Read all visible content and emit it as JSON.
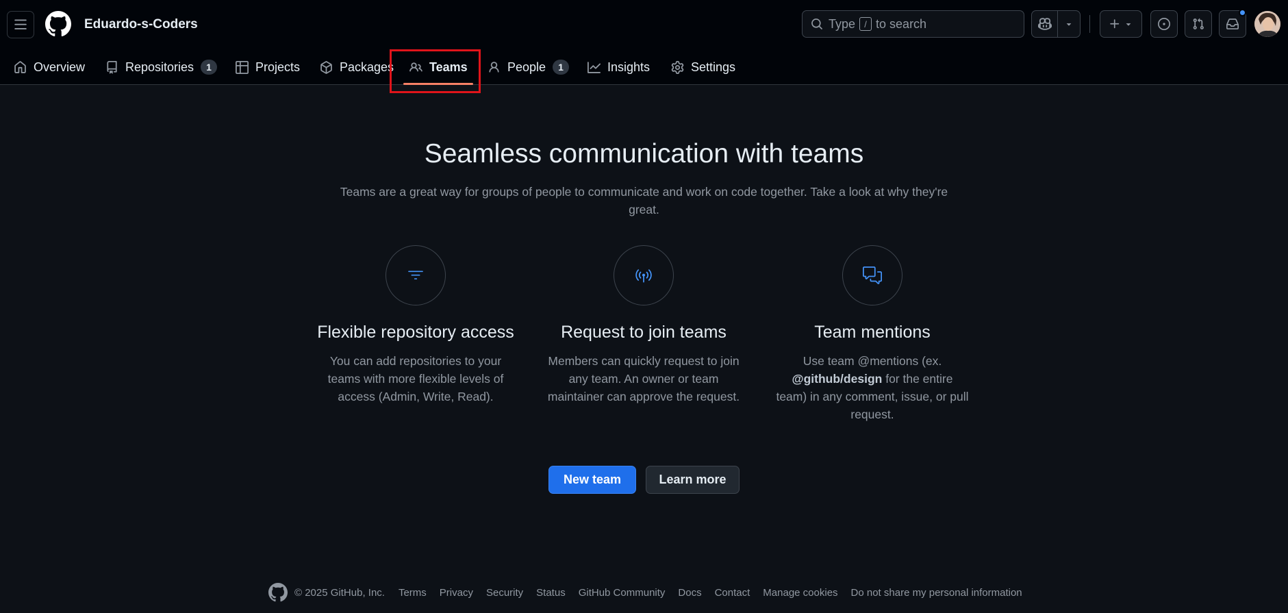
{
  "header": {
    "org_name": "Eduardo-s-Coders",
    "search": {
      "prefix": "Type",
      "key": "/",
      "suffix": "to search"
    },
    "notification_dot_color": "#4493f8"
  },
  "nav": {
    "tabs": [
      {
        "label": "Overview",
        "icon": "home-icon"
      },
      {
        "label": "Repositories",
        "icon": "repo-icon",
        "count": "1"
      },
      {
        "label": "Projects",
        "icon": "table-icon"
      },
      {
        "label": "Packages",
        "icon": "package-icon"
      },
      {
        "label": "Teams",
        "icon": "people-icon",
        "active": true
      },
      {
        "label": "People",
        "icon": "person-icon",
        "count": "1"
      },
      {
        "label": "Insights",
        "icon": "graph-icon"
      },
      {
        "label": "Settings",
        "icon": "gear-icon"
      }
    ],
    "active_underline_color": "#f78166",
    "highlight_color": "#e0141a"
  },
  "main": {
    "title": "Seamless communication with teams",
    "description": "Teams are a great way for groups of people to communicate and work on code together. Take a look at why they're great.",
    "features": [
      {
        "icon": "filter-icon",
        "title": "Flexible repository access",
        "text": "You can add repositories to your teams with more flexible levels of access (Admin, Write, Read)."
      },
      {
        "icon": "broadcast-icon",
        "title": "Request to join teams",
        "text": "Members can quickly request to join any team. An owner or team maintainer can approve the request."
      },
      {
        "icon": "comment-discussion-icon",
        "title": "Team mentions",
        "text_before": "Use team @mentions (ex.",
        "text_bold": "@github/design",
        "text_after": "for the entire team) in any comment, issue, or pull request."
      }
    ],
    "new_team_label": "New team",
    "learn_more_label": "Learn more",
    "accent_color": "#1f6feb",
    "icon_color": "#4493f8"
  },
  "footer": {
    "copyright": "© 2025 GitHub, Inc.",
    "links": [
      "Terms",
      "Privacy",
      "Security",
      "Status",
      "GitHub Community",
      "Docs",
      "Contact",
      "Manage cookies",
      "Do not share my personal information"
    ]
  }
}
